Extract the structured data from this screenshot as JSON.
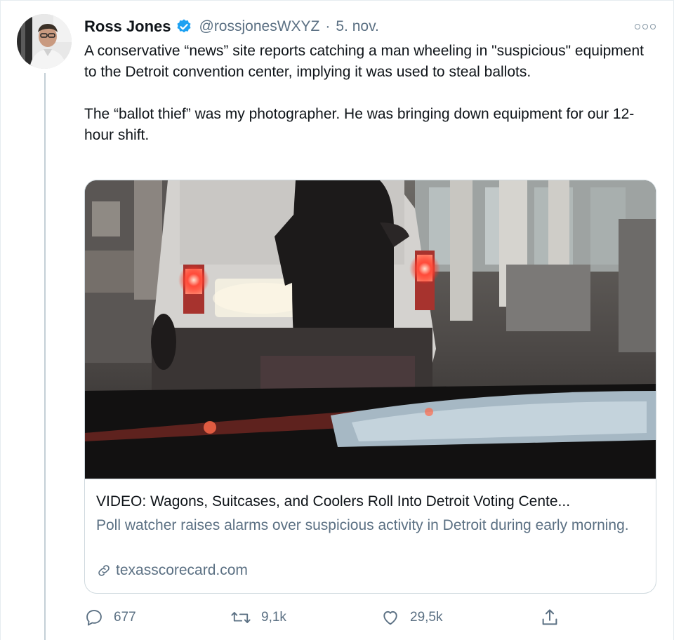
{
  "author": {
    "name": "Ross Jones",
    "handle": "@rossjonesWXYZ",
    "separator": "·",
    "date": "5. nov.",
    "verified_color": "#1da1f2"
  },
  "tweet": {
    "text": "A conservative “news” site reports catching a man wheeling in \"suspicious\" equipment to the Detroit convention center, implying it was used to steal ballots.\n\nThe “ballot thief” was my photographer. He was bringing down equipment for our 12-hour shift."
  },
  "card": {
    "title": "VIDEO: Wagons, Suitcases, and Coolers Roll Into Detroit Voting Cente...",
    "description": "Poll watcher raises alarms over suspicious activity in Detroit during early morning.",
    "domain": "texasscorecard.com",
    "domain_icon": "link-icon"
  },
  "actions": {
    "reply_count": "677",
    "retweet_count": "9,1k",
    "like_count": "29,5k",
    "icons": [
      "reply-icon",
      "retweet-icon",
      "like-icon",
      "share-icon"
    ]
  },
  "colors": {
    "secondary_text": "#5b7083",
    "border": "#cfd9de",
    "brand_blue": "#1da1f2"
  }
}
